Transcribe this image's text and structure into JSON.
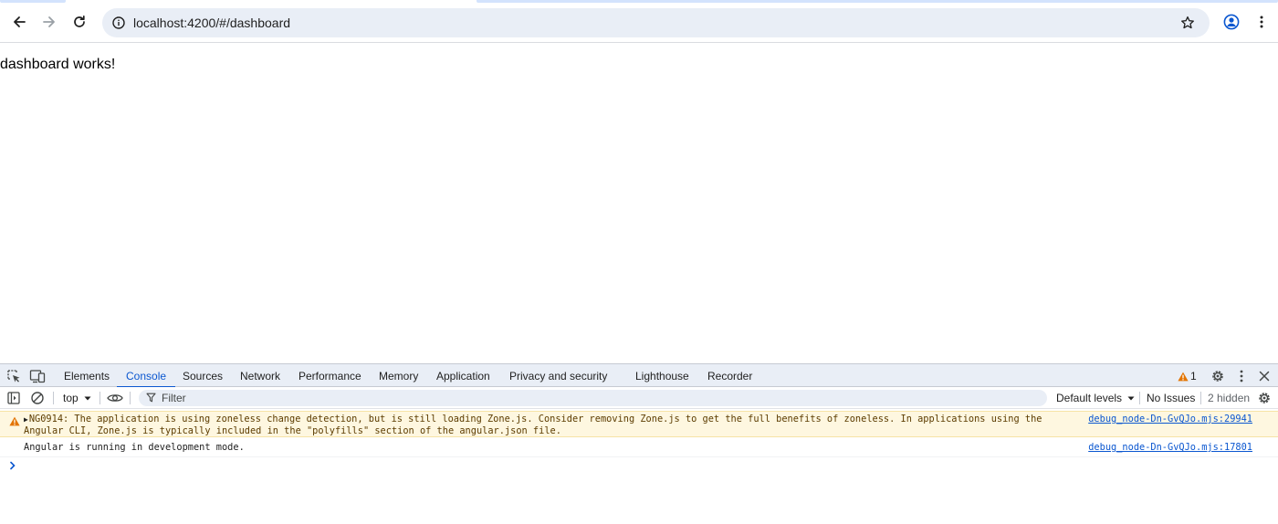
{
  "browser": {
    "url": "localhost:4200/#/dashboard",
    "icons": [
      "back-icon",
      "forward-icon",
      "reload-icon",
      "site-info-icon",
      "bookmark-star-icon",
      "profile-icon",
      "kebab-menu-icon"
    ]
  },
  "page": {
    "text": "dashboard works!"
  },
  "devtools": {
    "tabs": [
      {
        "label": "Elements",
        "active": false
      },
      {
        "label": "Console",
        "active": true
      },
      {
        "label": "Sources",
        "active": false
      },
      {
        "label": "Network",
        "active": false
      },
      {
        "label": "Performance",
        "active": false
      },
      {
        "label": "Memory",
        "active": false
      },
      {
        "label": "Application",
        "active": false
      },
      {
        "label": "Privacy and security",
        "active": false
      },
      {
        "label": "Lighthouse",
        "active": false
      },
      {
        "label": "Recorder",
        "active": false
      }
    ],
    "warning_count": "1",
    "console_toolbar": {
      "context": "top",
      "filter_placeholder": "Filter",
      "levels": "Default levels",
      "issues": "No Issues",
      "hidden": "2 hidden"
    },
    "messages": [
      {
        "level": "warning",
        "text": "NG0914: The application is using zoneless change detection, but is still loading Zone.js. Consider removing Zone.js to get the full benefits of zoneless. In applications using the Angular CLI, Zone.js is typically included in the \"polyfills\" section of the angular.json file.",
        "source": "debug_node-Dn-GvQJo.mjs:29941"
      },
      {
        "level": "info",
        "text": "Angular is running in development mode.",
        "source": "debug_node-Dn-GvQJo.mjs:17801"
      }
    ]
  },
  "colors": {
    "accent": "#0b57d0",
    "warning_bg": "#fef7e0",
    "warning_icon": "#e37400",
    "toolbar_bg": "#e9eef6"
  }
}
